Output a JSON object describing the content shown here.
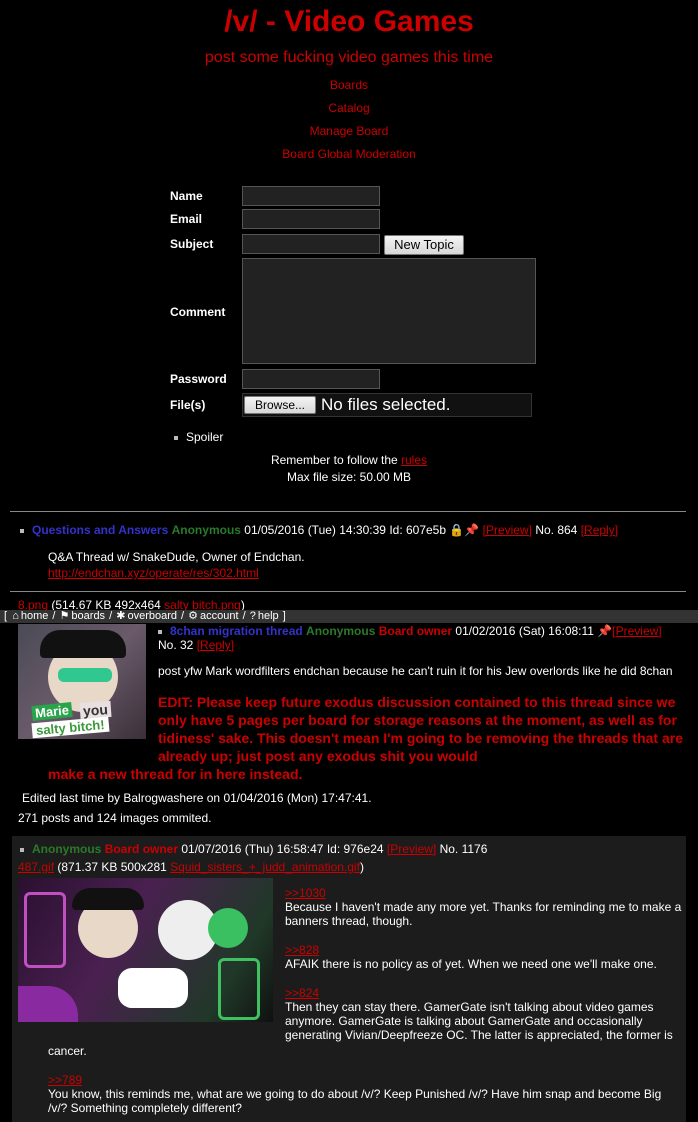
{
  "header": {
    "title": "/v/ - Video Games",
    "subtitle": "post some fucking video games this time",
    "links": [
      "Boards",
      "Catalog",
      "Manage Board",
      "Board Global Moderation"
    ]
  },
  "form": {
    "name_label": "Name",
    "email_label": "Email",
    "subject_label": "Subject",
    "new_topic_button": "New Topic",
    "comment_label": "Comment",
    "password_label": "Password",
    "files_label": "File(s)",
    "browse_button": "Browse...",
    "no_files": "No files selected.",
    "spoiler_label": "Spoiler",
    "rules_prefix": "Remember to follow the ",
    "rules_link": "rules",
    "max_size": "Max file size: 50.00 MB"
  },
  "thread1": {
    "subject": "Questions and Answers",
    "name": "Anonymous",
    "datetime": "01/05/2016 (Tue) 14:30:39",
    "id_label": "Id: 607e5b",
    "preview": "[Preview]",
    "no": "No. 864",
    "reply": "[Reply]",
    "body_line": "Q&A Thread w/ SnakeDude, Owner of Endchan.",
    "body_link": "http://endchan.xyz/operate/res/302.html"
  },
  "file_line": {
    "name": "8.png",
    "info": "(514.67 KB 492x464",
    "orig": "salty bitch.png",
    "close": ")"
  },
  "topnav": {
    "home": "home",
    "boards": "boards",
    "overboard": "overboard",
    "account": "account",
    "help": "help"
  },
  "thread2": {
    "subject": "8chan migration thread",
    "name": "Anonymous",
    "role": "Board owner",
    "datetime": "01/02/2016 (Sat) 16:08:11",
    "preview": "[Preview]",
    "no": "No. 32",
    "reply": "[Reply]",
    "body": "post yfw Mark wordfilters endchan because he can't ruin it for his Jew overlords like he did 8chan",
    "edit_text_1": "EDIT: Please keep future exodus discussion contained to this thread since we only have 5 pages per board for storage reasons at the moment, as well as for tidiness' sake. This doesn't mean I'm going to be removing the threads that are already up; just post any exodus shit you would",
    "edit_text_2": "make a new thread for in here instead.",
    "edited_note": "Edited last time by Balrogwashere on 01/04/2016 (Mon) 17:47:41.",
    "omitted": "271 posts and 124 images ommited.",
    "thumb_text_1": "Marie",
    "thumb_text_2": "you",
    "thumb_text_3": "salty bitch!"
  },
  "reply": {
    "name": "Anonymous",
    "role": "Board owner",
    "datetime": "01/07/2016 (Thu) 16:58:47",
    "id_label": "Id: 976e24",
    "preview": "[Preview]",
    "no": "No. 1176",
    "file_name": "487.gif",
    "file_info": "(871.37 KB 500x281",
    "file_orig": "Squid_sisters_+_judd_animation.gif",
    "file_close": ")",
    "q1": ">>1030",
    "t1": "Because I haven't made any more yet. Thanks for reminding me to make a banners thread, though.",
    "q2": ">>828",
    "t2": "AFAIK there is no policy as of yet. When we need one we'll make one.",
    "q3": ">>824",
    "t3a": "Then they can stay there. GamerGate isn't talking about video games anymore. GamerGate is talking about GamerGate and occasionally generating Vivian/Deepfreeze OC. The latter is appreciated, the former is",
    "t3b": "cancer.",
    "q4": ">>789",
    "t4": "You know, this reminds me, what are we going to do about /v/? Keep Punished /v/? Have him snap and become Big /v/? Something completely different?"
  },
  "colors": {
    "background": "#000000",
    "accent_red": "#cc0000",
    "subject_blue": "#3333cc",
    "name_green": "#2a7a2a",
    "reply_bg": "#1c1c1c"
  }
}
